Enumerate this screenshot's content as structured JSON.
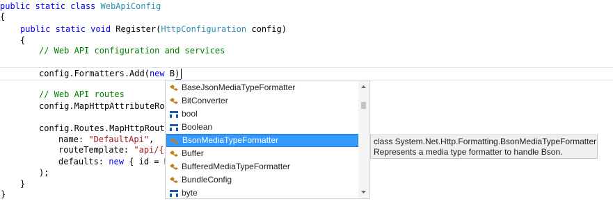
{
  "code": {
    "line1": {
      "kw": "public static class ",
      "ty": "WebApiConfig"
    },
    "line2": "{",
    "line3": {
      "kw": "public static void ",
      "text": "Register(",
      "ty": "HttpConfiguration",
      "text2": " config)"
    },
    "line4": "{",
    "line5": "// Web API configuration and services",
    "line6": {
      "text": "config.Formatters.Add(",
      "kw": "new",
      "typed": " B)"
    },
    "line7": "// Web API routes",
    "line8": "config.MapHttpAttributeRou",
    "line9": "config.Routes.MapHttpRoute",
    "line10": {
      "text": "name: ",
      "str": "\"DefaultApi\"",
      "text2": ","
    },
    "line11": {
      "text": "routeTemplate: ",
      "str": "\"api/{c"
    },
    "line12": {
      "text": "defaults: ",
      "kw": "new",
      "text2": " { id = R"
    },
    "line13": ");",
    "line14": "}",
    "line15": "}"
  },
  "completion": {
    "items": [
      {
        "label": "BaseJsonMediaTypeFormatter",
        "icon": "class-icon"
      },
      {
        "label": "BitConverter",
        "icon": "class-icon"
      },
      {
        "label": "bool",
        "icon": "struct-icon"
      },
      {
        "label": "Boolean",
        "icon": "struct-icon"
      },
      {
        "label": "BsonMediaTypeFormatter",
        "icon": "class-icon"
      },
      {
        "label": "Buffer",
        "icon": "class-icon"
      },
      {
        "label": "BufferedMediaTypeFormatter",
        "icon": "class-icon"
      },
      {
        "label": "BundleConfig",
        "icon": "class-icon"
      },
      {
        "label": "byte",
        "icon": "struct-icon"
      }
    ],
    "selected_index": 4
  },
  "tooltip": {
    "line1": "class System.Net.Http.Formatting.BsonMediaTypeFormatter",
    "line2": "Represents a media type formatter to handle Bson."
  },
  "colors": {
    "keyword": "#0000ff",
    "type": "#2b91af",
    "comment": "#008000",
    "string": "#a31515",
    "selection": "#3399ff"
  }
}
